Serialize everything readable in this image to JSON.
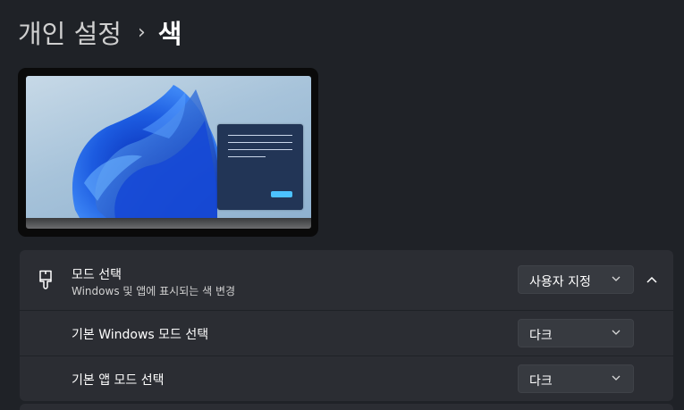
{
  "header": {
    "parent": "개인 설정",
    "separator": "›",
    "current": "색"
  },
  "preview": {
    "accent_color": "#4cc2ff",
    "window_color": "#223556"
  },
  "mode_setting": {
    "icon": "paint-brush-icon",
    "title": "모드 선택",
    "subtitle": "Windows 및 앱에 표시되는 색 변경",
    "selected": "사용자 지정",
    "expanded": true,
    "sub_rows": [
      {
        "label": "기본 Windows 모드 선택",
        "selected": "다크"
      },
      {
        "label": "기본 앱 모드 선택",
        "selected": "다크"
      }
    ]
  }
}
